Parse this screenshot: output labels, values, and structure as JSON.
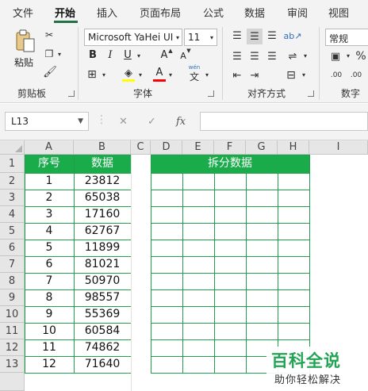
{
  "tabs": [
    {
      "label": "文件"
    },
    {
      "label": "开始"
    },
    {
      "label": "插入"
    },
    {
      "label": "页面布局"
    },
    {
      "label": "公式"
    },
    {
      "label": "数据"
    },
    {
      "label": "审阅"
    },
    {
      "label": "视图"
    }
  ],
  "ribbon": {
    "clipboard": {
      "paste_label": "粘贴",
      "group_label": "剪贴板"
    },
    "font": {
      "font_name": "Microsoft YaHei UI",
      "font_size": "11",
      "group_label": "字体",
      "bold": "B",
      "italic": "I",
      "underline": "U",
      "grow": "A",
      "shrink": "A",
      "phonetic_top": "wén",
      "phonetic_char": "文",
      "fill_color": "#ffff00",
      "font_color": "#ff0000"
    },
    "alignment": {
      "group_label": "对齐方式"
    },
    "number": {
      "format": "常规",
      "group_label": "数字"
    }
  },
  "formula_bar": {
    "name_box": "L13",
    "cancel": "✕",
    "enter": "✓",
    "fx": "fx",
    "value": ""
  },
  "columns": [
    "A",
    "B",
    "C",
    "D",
    "E",
    "F",
    "G",
    "H",
    "I"
  ],
  "rows": [
    "1",
    "2",
    "3",
    "4",
    "5",
    "6",
    "7",
    "8",
    "9",
    "10",
    "11",
    "12",
    "13"
  ],
  "table": {
    "headers": {
      "seq": "序号",
      "data": "数据",
      "split": "拆分数据"
    },
    "records": [
      {
        "seq": "1",
        "value": "23812"
      },
      {
        "seq": "2",
        "value": "65038"
      },
      {
        "seq": "3",
        "value": "17160"
      },
      {
        "seq": "4",
        "value": "62767"
      },
      {
        "seq": "5",
        "value": "11899"
      },
      {
        "seq": "6",
        "value": "81021"
      },
      {
        "seq": "7",
        "value": "50970"
      },
      {
        "seq": "8",
        "value": "98557"
      },
      {
        "seq": "9",
        "value": "55369"
      },
      {
        "seq": "10",
        "value": "60584"
      },
      {
        "seq": "11",
        "value": "74862"
      },
      {
        "seq": "12",
        "value": "71640"
      }
    ]
  },
  "watermark": {
    "title": "百科全说",
    "subtitle": "助你轻松解决"
  },
  "colors": {
    "accent": "#217346",
    "header_fill": "#1aab4b",
    "border": "#20a04a"
  }
}
